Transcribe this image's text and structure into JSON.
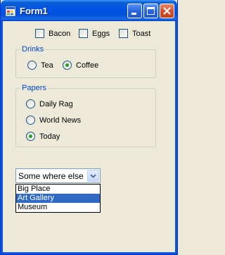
{
  "window": {
    "title": "Form1",
    "icon": "app-form-icon",
    "controls": [
      "minimize-icon",
      "maximize-icon",
      "close-icon"
    ]
  },
  "food": {
    "items": [
      {
        "label": "Bacon",
        "checked": false
      },
      {
        "label": "Eggs",
        "checked": false
      },
      {
        "label": "Toast",
        "checked": false
      }
    ]
  },
  "drinks": {
    "title": "Drinks",
    "options": [
      {
        "label": "Tea",
        "checked": false
      },
      {
        "label": "Coffee",
        "checked": true
      }
    ]
  },
  "papers": {
    "title": "Papers",
    "options": [
      {
        "label": "Daily Rag",
        "checked": false
      },
      {
        "label": "World News",
        "checked": false
      },
      {
        "label": "Today",
        "checked": true
      }
    ]
  },
  "location": {
    "value": "Some where else",
    "options": [
      {
        "label": "Big Place",
        "highlighted": false
      },
      {
        "label": "Art Gallery",
        "highlighted": true
      },
      {
        "label": "Museum",
        "highlighted": false
      }
    ]
  },
  "colors": {
    "title_bar": "#0054e3",
    "face": "#ece9d8",
    "group_title": "#0046d5",
    "radio_dot": "#21a121",
    "highlight": "#316ac5"
  }
}
